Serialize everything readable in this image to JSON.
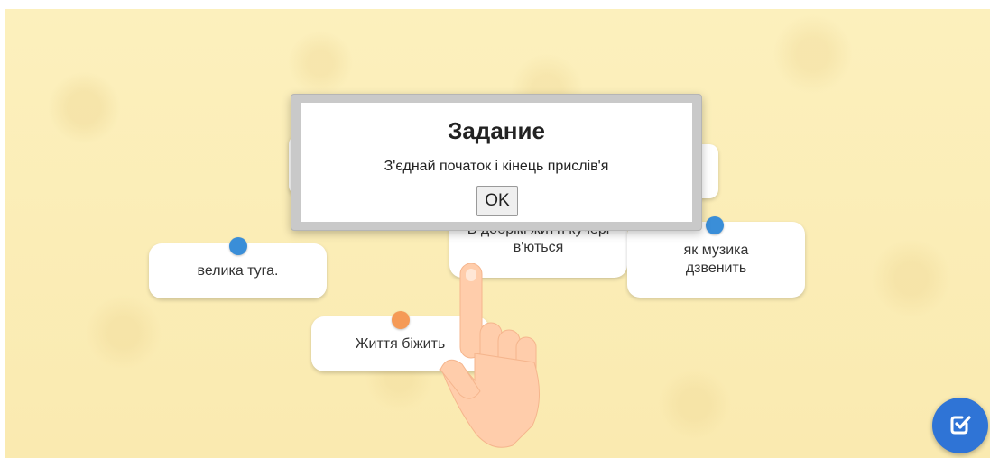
{
  "cards": {
    "left": "велика туга.",
    "center": "В добрім житті кучері в'ються",
    "right": "як музика дзвенить",
    "bottom": "Життя біжить"
  },
  "dialog": {
    "title": "Задание",
    "text": "З'єднай початок і кінець прислів'я",
    "ok_label": "OK"
  },
  "colors": {
    "background": "#fbeeb6",
    "dot_blue": "#3a8ed8",
    "dot_orange": "#f59a56",
    "check_button": "#2f74d6",
    "hand": "#ffcdab"
  },
  "icons": {
    "hint": "pointing-hand-icon",
    "check": "check-square-icon"
  }
}
